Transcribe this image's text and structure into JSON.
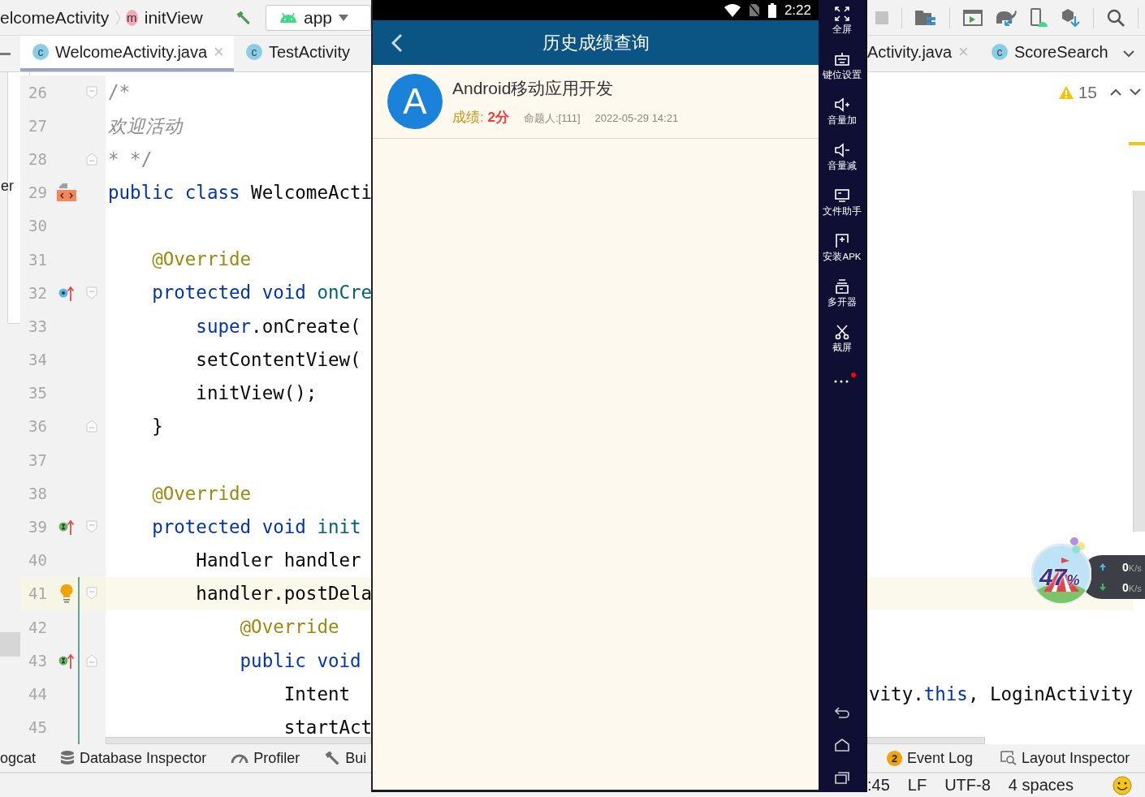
{
  "ide": {
    "breadcrumb": {
      "class_name": "elcomeActivity",
      "method_badge": "m",
      "method_name": "initView"
    },
    "run_config": "app",
    "tabs": [
      {
        "label": "WelcomeActivity.java",
        "icon_letter": "c",
        "close": "×",
        "selected": true
      },
      {
        "label": "TestActivity",
        "icon_letter": "c",
        "selected": false
      }
    ],
    "tabs_right": [
      {
        "label": "Activity.java",
        "close": "×",
        "selected": false
      },
      {
        "label": "ScoreSearch",
        "icon_letter": "c",
        "selected": false
      }
    ],
    "project_panel": {
      "label": "er"
    },
    "inspections": {
      "warnings": "15"
    },
    "lines": [
      {
        "number": "26",
        "fold": {
          "kind": "start"
        },
        "tokens": [
          {
            "text": "/*",
            "kind": "comment"
          }
        ]
      },
      {
        "number": "27",
        "tokens": [
          {
            "text": "欢迎活动",
            "kind": "doc"
          }
        ]
      },
      {
        "number": "28",
        "fold": {
          "kind": "end"
        },
        "tokens": [
          {
            "text": "* */",
            "kind": "comment"
          }
        ]
      },
      {
        "number": "29",
        "gutter_icon": {
          "kind": "class"
        },
        "tokens": [
          {
            "text": "public class",
            "kind": "keyword"
          },
          {
            "text": " WelcomeActi",
            "kind": "plain"
          }
        ]
      },
      {
        "number": "30"
      },
      {
        "number": "31",
        "tokens": [
          {
            "text": "    @Override",
            "kind": "annotation"
          }
        ]
      },
      {
        "number": "32",
        "gutter_icon": {
          "kind": "override"
        },
        "fold": {
          "kind": "start"
        },
        "tokens": [
          {
            "text": "    protected void",
            "kind": "keyword"
          },
          {
            "text": " onCre",
            "kind": "method"
          }
        ]
      },
      {
        "number": "33",
        "tokens": [
          {
            "text": "        super",
            "kind": "keyword"
          },
          {
            "text": ".onCreate(",
            "kind": "plain"
          }
        ]
      },
      {
        "number": "34",
        "tokens": [
          {
            "text": "        setContentView(",
            "kind": "plain"
          }
        ]
      },
      {
        "number": "35",
        "tokens": [
          {
            "text": "        initView();",
            "kind": "plain"
          }
        ]
      },
      {
        "number": "36",
        "fold": {
          "kind": "end"
        },
        "tokens": [
          {
            "text": "    }",
            "kind": "plain"
          }
        ]
      },
      {
        "number": "37"
      },
      {
        "number": "38",
        "tokens": [
          {
            "text": "    @Override",
            "kind": "annotation"
          }
        ]
      },
      {
        "number": "39",
        "gutter_icon": {
          "kind": "implement"
        },
        "fold": {
          "kind": "start"
        },
        "tokens": [
          {
            "text": "    protected void",
            "kind": "keyword"
          },
          {
            "text": " init",
            "kind": "method"
          }
        ]
      },
      {
        "number": "40",
        "tokens": [
          {
            "text": "        Handler handler",
            "kind": "plain"
          }
        ]
      },
      {
        "number": "41",
        "gutter_icon": {
          "kind": "bulb"
        },
        "fold": {
          "kind": "start"
        },
        "current": true,
        "changed": true,
        "tokens": [
          {
            "text": "        handler.postDela",
            "kind": "plain"
          }
        ]
      },
      {
        "number": "42",
        "changed": true,
        "tokens": [
          {
            "text": "            @Override",
            "kind": "annotation"
          }
        ]
      },
      {
        "number": "43",
        "gutter_icon": {
          "kind": "implement"
        },
        "fold": {
          "kind": "end"
        },
        "changed": true,
        "tokens": [
          {
            "text": "            public void",
            "kind": "keyword"
          }
        ]
      },
      {
        "number": "44",
        "changed": true,
        "tokens": [
          {
            "text": "                Intent",
            "kind": "plain"
          }
        ],
        "tail": [
          {
            "text": "vity.",
            "kind": "plain"
          },
          {
            "text": "this",
            "kind": "keyword"
          },
          {
            "text": ", LoginActivity",
            "kind": "plain"
          }
        ]
      },
      {
        "number": "45",
        "changed": true,
        "tokens": [
          {
            "text": "                startAct",
            "kind": "plain"
          }
        ]
      }
    ],
    "tool_windows_left": [
      {
        "label": "ogcat"
      },
      {
        "label": "Database Inspector",
        "kind": "database"
      },
      {
        "label": "Profiler",
        "kind": "profiler"
      },
      {
        "label": "Bui",
        "kind": "build"
      }
    ],
    "tool_windows_right": [
      {
        "label": "Event Log",
        "badge": "2"
      },
      {
        "label": "Layout Inspector",
        "kind": "layout-inspector"
      }
    ],
    "status_bar": [
      ":45",
      "LF",
      "UTF-8",
      "4 spaces"
    ]
  },
  "emulator": {
    "status_bar": {
      "time": "2:22"
    },
    "app_bar": {
      "title": "历史成绩查询"
    },
    "records": [
      {
        "avatar": "A",
        "title": "Android移动应用开发",
        "score_label": "成绩: ",
        "score": "2分",
        "author": "命题人:[111]",
        "date": "2022-05-29 14:21"
      }
    ],
    "sidebar": [
      {
        "label": "全屏",
        "kind": "fullscreen"
      },
      {
        "label": "键位设置",
        "kind": "keymap"
      },
      {
        "label": "音量加",
        "kind": "volume-up"
      },
      {
        "label": "音量减",
        "kind": "volume-down"
      },
      {
        "label": "文件助手",
        "kind": "files"
      },
      {
        "label": "安装APK",
        "kind": "apk"
      },
      {
        "label": "多开器",
        "kind": "multi"
      },
      {
        "label": "截屏",
        "kind": "screenshot"
      }
    ],
    "more_notification": true
  },
  "speed_widget": {
    "percent": "47",
    "percent_sign": "%",
    "upload": {
      "value": "0",
      "unit": "K/s"
    },
    "download": {
      "value": "0",
      "unit": "K/s"
    }
  }
}
